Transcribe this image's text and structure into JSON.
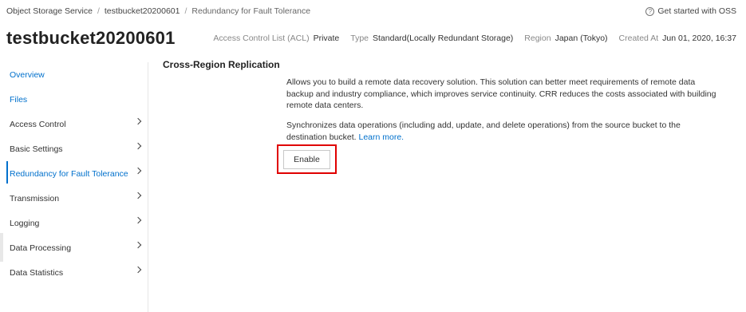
{
  "breadcrumb": {
    "items": [
      "Object Storage Service",
      "testbucket20200601",
      "Redundancy for Fault Tolerance"
    ],
    "separator": "/"
  },
  "help": {
    "icon": "question-circle-icon",
    "glyph": "?",
    "label": "Get started with OSS"
  },
  "bucket": {
    "name": "testbucket20200601",
    "meta": {
      "acl_label": "Access Control List (ACL)",
      "acl_value": "Private",
      "type_label": "Type",
      "type_value": "Standard(Locally Redundant Storage)",
      "region_label": "Region",
      "region_value": "Japan (Tokyo)",
      "created_label": "Created At",
      "created_value": "Jun 01, 2020, 16:37"
    }
  },
  "sidebar": {
    "items": [
      {
        "label": "Overview"
      },
      {
        "label": "Files"
      },
      {
        "label": "Access Control"
      },
      {
        "label": "Basic Settings"
      },
      {
        "label": "Redundancy for Fault Tolerance"
      },
      {
        "label": "Transmission"
      },
      {
        "label": "Logging"
      },
      {
        "label": "Data Processing"
      },
      {
        "label": "Data Statistics"
      }
    ]
  },
  "main": {
    "title": "Cross-Region Replication",
    "description1": "Allows you to build a remote data recovery solution. This solution can better meet requirements of remote data backup and industry compliance, which improves service continuity. CRR reduces the costs associated with building remote data centers.",
    "description2": "Synchronizes data operations (including add, update, and delete operations) from the source bucket to the destination bucket.",
    "learn_more": "Learn more.",
    "enable_label": "Enable"
  },
  "colors": {
    "accent": "#0070cc",
    "highlight": "#e00000"
  }
}
